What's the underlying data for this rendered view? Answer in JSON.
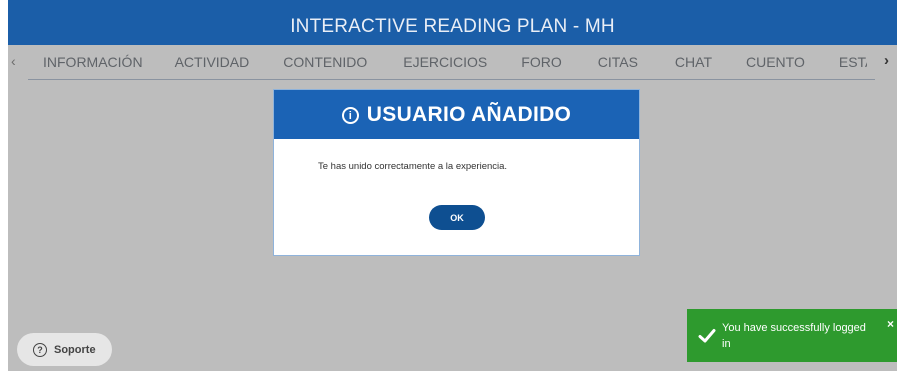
{
  "header": {
    "title": "INTERACTIVE READING PLAN - MH"
  },
  "nav": {
    "left_arrow": "‹",
    "right_arrow": "›",
    "tabs": [
      "INFORMACIÓN",
      "ACTIVIDAD",
      "CONTENIDO",
      "EJERCICIOS",
      "FORO",
      "CITAS",
      "CHAT",
      "CUENTO",
      "ESTADÍSTI("
    ]
  },
  "modal": {
    "icon": "info-icon",
    "icon_glyph": "i",
    "title": "USUARIO AÑADIDO",
    "message": "Te has unido correctamente a la experiencia.",
    "ok_label": "OK"
  },
  "support": {
    "icon": "question-icon",
    "icon_glyph": "?",
    "label": "Soporte"
  },
  "toast": {
    "message": "You have successfully logged in",
    "close": "×",
    "color": "#2e9a2e"
  },
  "colors": {
    "header_bg": "#1b5ea8",
    "modal_header_bg": "#1b63b5",
    "ok_button": "#0e4f91",
    "overlay": "#bdbdbd"
  }
}
